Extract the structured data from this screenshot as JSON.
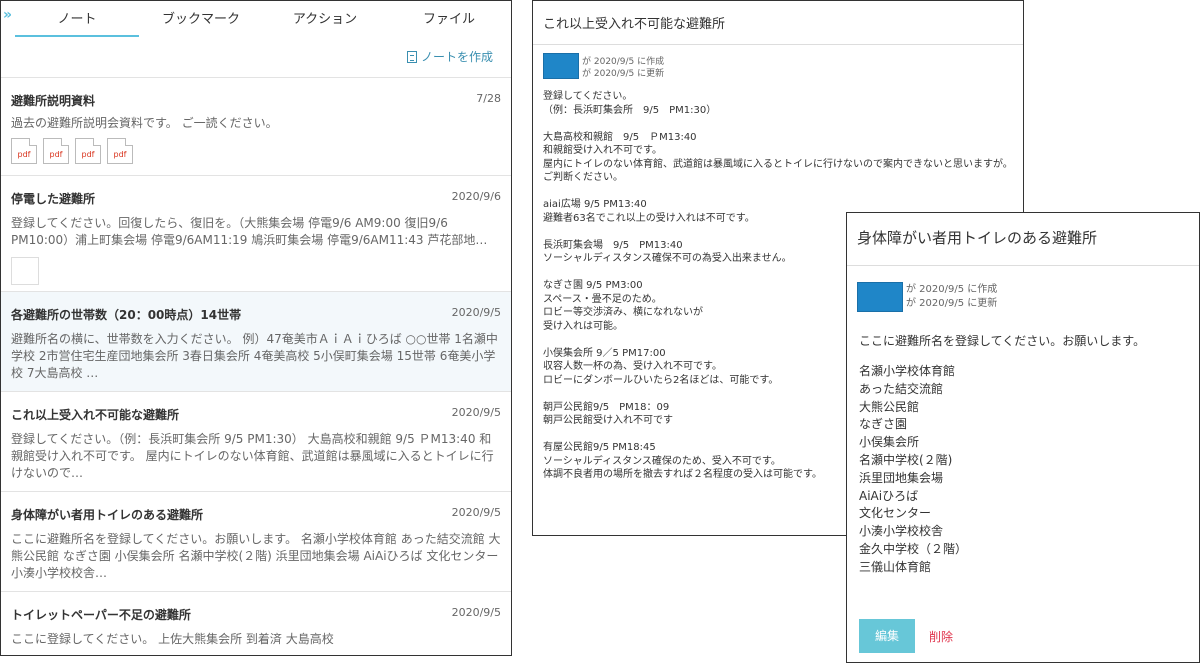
{
  "left_panel": {
    "expand_label": "»",
    "tabs": [
      {
        "label": "ノート"
      },
      {
        "label": "ブックマーク"
      },
      {
        "label": "アクション"
      },
      {
        "label": "ファイル"
      }
    ],
    "create_note_label": "ノートを作成",
    "notes": [
      {
        "title": "避難所説明資料",
        "date": "7/28",
        "body": "過去の避難所説明会資料です。 ご一読ください。",
        "pdf_labels": [
          "pdf",
          "pdf",
          "pdf",
          "pdf"
        ]
      },
      {
        "title": "停電した避難所",
        "date": "2020/9/6",
        "body": "登録してください。回復したら、復旧を。（大熊集会場 停電9/6 AM9:00 復旧9/6 PM10:00）浦上町集会場 停電9/6AM11:19 鳩浜町集会場 停電9/6AM11:43 芦花部地…"
      },
      {
        "title": "各避難所の世帯数（20：00時点）14世帯",
        "date": "2020/9/5",
        "body": "避難所名の横に、世帯数を入力ください。 例）47奄美市ＡｉＡｉひろば ○○世帯 1名瀬中学校 2市営住宅生産団地集会所 3春日集会所 4奄美高校 5小俣町集会場 15世帯 6奄美小学校 7大島高校 …"
      },
      {
        "title": "これ以上受入れ不可能な避難所",
        "date": "2020/9/5",
        "body": "登録してください。（例：長浜町集会所 9/5 PM1:30） 大島高校和親館 9/5 ＰM13:40 和親館受け入れ不可です。 屋内にトイレのない体育館、武道館は暴風域に入るとトイレに行けないので…"
      },
      {
        "title": "身体障がい者用トイレのある避難所",
        "date": "2020/9/5",
        "body": "ここに避難所名を登録してください。お願いします。 名瀬小学校体育館 あった結交流館 大熊公民館 なぎさ園 小俣集会所 名瀬中学校(２階) 浜里団地集会場 AiAiひろば 文化センター 小湊小学校校舎…"
      },
      {
        "title": "トイレットペーパー不足の避難所",
        "date": "2020/9/5",
        "body": "ここに登録してください。 上佐大熊集会所 到着済 大島高校"
      }
    ]
  },
  "middle_panel": {
    "title": "これ以上受入れ不可能な避難所",
    "created": "が 2020/9/5 に作成",
    "updated": "が 2020/9/5 に更新",
    "content": "登録してください。\n（例：長浜町集会所　9/5　PM1:30）\n\n大島高校和親館　9/5　ＰM13:40\n和親館受け入れ不可です。\n屋内にトイレのない体育館、武道館は暴風域に入るとトイレに行けないので案内できないと思いますが。\nご判断ください。\n\naiai広場 9/5 PM13:40\n避難者63名でこれ以上の受け入れは不可です。\n\n長浜町集会場　9/5　PM13:40\nソーシャルディスタンス確保不可の為受入出来ません。\n\nなぎさ園 9/5 PM3:00\nスペース・畳不足のため。\nロビー等交渉済み、横になれないが\n受け入れは可能。\n\n小俣集会所 9／5 PM17:00\n収容人数一杯の為、受け入れ不可です。\nロビーにダンボールひいたら2名ほどは、可能です。\n\n朝戸公民館9/5　PM18：09\n朝戸公民館受け入れ不可です\n\n有屋公民館9/5 PM18:45\nソーシャルディスタンス確保のため、受入不可です。\n体調不良者用の場所を撤去すれば２名程度の受入は可能です。"
  },
  "right_panel": {
    "title": "身体障がい者用トイレのある避難所",
    "created": "が 2020/9/5 に作成",
    "updated": "が 2020/9/5 に更新",
    "intro": "ここに避難所名を登録してください。お願いします。",
    "shelters": [
      "名瀬小学校体育館",
      "あった結交流館",
      "大熊公民館",
      "なぎさ園",
      "小俣集会所",
      "名瀬中学校(２階)",
      "浜里団地集会場",
      "AiAiひろば",
      "文化センター",
      "小湊小学校校舎",
      "金久中学校（２階）",
      "三儀山体育館"
    ],
    "edit_label": "編集",
    "delete_label": "削除"
  },
  "colors": {
    "accent": "#5bc0de",
    "edit_button": "#67c7d8",
    "delete": "#e0344c",
    "avatar": "#1f86c8"
  }
}
